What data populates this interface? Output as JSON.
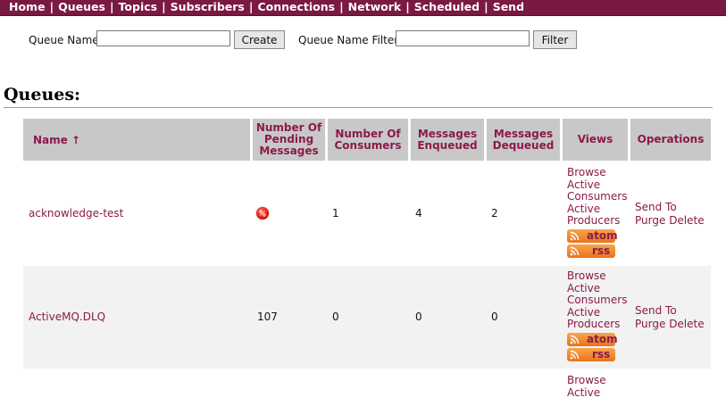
{
  "nav": {
    "items": [
      "Home",
      "Queues",
      "Topics",
      "Subscribers",
      "Connections",
      "Network",
      "Scheduled",
      "Send"
    ],
    "separator": "|"
  },
  "create_form": {
    "queue_name_label": "Queue Name",
    "queue_name_value": "",
    "create_button": "Create",
    "filter_label": "Queue Name Filter",
    "filter_value": "",
    "filter_button": "Filter"
  },
  "page_title": "Queues:",
  "table": {
    "headers": {
      "name": "Name ↑",
      "pending": [
        "Number Of",
        "Pending",
        "Messages"
      ],
      "consumers": [
        "Number Of",
        "Consumers"
      ],
      "enqueued": [
        "Messages",
        "Enqueued"
      ],
      "dequeued": [
        "Messages",
        "Dequeued"
      ],
      "views": "Views",
      "operations": "Operations"
    },
    "rows": [
      {
        "name": "acknowledge-test",
        "pending": "",
        "pending_icon": "red-dot-icon",
        "consumers": "1",
        "enqueued": "4",
        "dequeued": "2",
        "views": [
          "Browse",
          "Active",
          "Consumers",
          "Active",
          "Producers"
        ],
        "feeds": [
          "atom",
          "rss"
        ],
        "ops": {
          "send_to": "Send To",
          "purge": "Purge",
          "delete": "Delete"
        }
      },
      {
        "name": "ActiveMQ.DLQ",
        "pending": "107",
        "consumers": "0",
        "enqueued": "0",
        "dequeued": "0",
        "views": [
          "Browse",
          "Active",
          "Consumers",
          "Active",
          "Producers"
        ],
        "feeds": [
          "atom",
          "rss"
        ],
        "ops": {
          "send_to": "Send To",
          "purge": "Purge",
          "delete": "Delete"
        }
      },
      {
        "views": [
          "Browse",
          "Active"
        ]
      }
    ]
  },
  "colors": {
    "nav_bg": "#7a1942",
    "link": "#8b1a4a",
    "header_bg": "#c8c8c8",
    "alt_row_bg": "#f2f2f2",
    "feed_badge": "#f0892b"
  }
}
